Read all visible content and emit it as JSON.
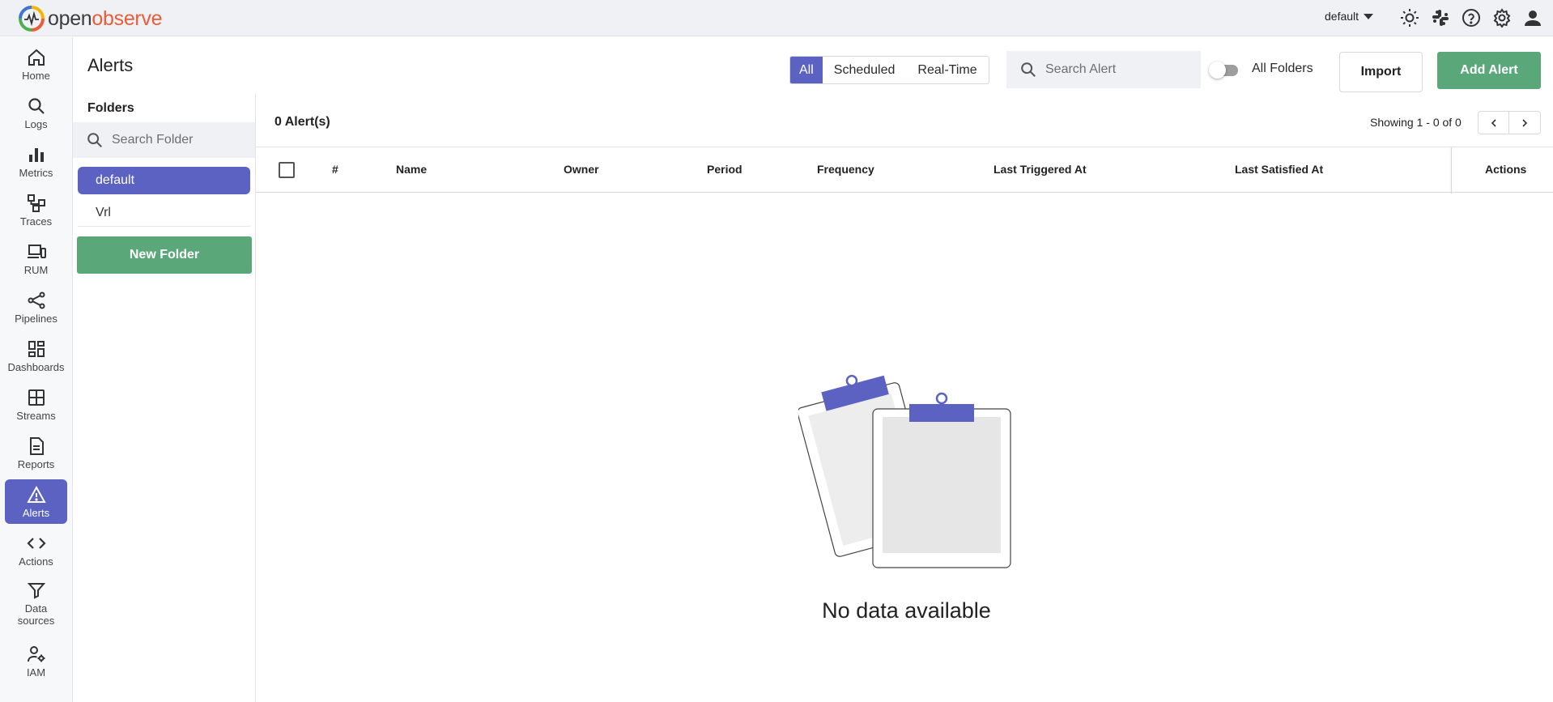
{
  "brand": {
    "name_part1": "open",
    "name_part2": "observe"
  },
  "header": {
    "org": "default",
    "icons": [
      "theme-toggle-icon",
      "slack-icon",
      "help-icon",
      "settings-icon",
      "user-icon"
    ]
  },
  "sidebar": {
    "items": [
      {
        "label": "Home",
        "icon": "home-icon"
      },
      {
        "label": "Logs",
        "icon": "search-icon"
      },
      {
        "label": "Metrics",
        "icon": "bar-chart-icon"
      },
      {
        "label": "Traces",
        "icon": "traces-icon"
      },
      {
        "label": "RUM",
        "icon": "devices-icon"
      },
      {
        "label": "Pipelines",
        "icon": "share-icon"
      },
      {
        "label": "Dashboards",
        "icon": "dashboard-icon"
      },
      {
        "label": "Streams",
        "icon": "grid-icon"
      },
      {
        "label": "Reports",
        "icon": "document-icon"
      },
      {
        "label": "Alerts",
        "icon": "warning-icon",
        "active": true
      },
      {
        "label": "Actions",
        "icon": "code-icon"
      },
      {
        "label": "Data sources",
        "label_line1": "Data",
        "label_line2": "sources",
        "icon": "filter-icon"
      },
      {
        "label": "IAM",
        "icon": "manage-accounts-icon"
      }
    ]
  },
  "page": {
    "title": "Alerts"
  },
  "folders": {
    "heading": "Folders",
    "search_placeholder": "Search Folder",
    "items": [
      {
        "label": "default",
        "active": true
      },
      {
        "label": "Vrl",
        "active": false
      }
    ],
    "new_folder_label": "New Folder"
  },
  "toolbar": {
    "filters": [
      "All",
      "Scheduled",
      "Real-Time"
    ],
    "active_filter": "All",
    "search_placeholder": "Search Alert",
    "all_folders_label": "All Folders",
    "all_folders_on": false,
    "import_label": "Import",
    "add_label": "Add Alert"
  },
  "table": {
    "count_label": "0 Alert(s)",
    "showing_label": "Showing 1 - 0 of 0",
    "columns": [
      "#",
      "Name",
      "Owner",
      "Period",
      "Frequency",
      "Last Triggered At",
      "Last Satisfied At",
      "Actions"
    ],
    "rows": [],
    "empty_text": "No data available"
  },
  "colors": {
    "primary": "#5b62c1",
    "success": "#5aa87a",
    "topbar_bg": "#f0f1f5"
  }
}
